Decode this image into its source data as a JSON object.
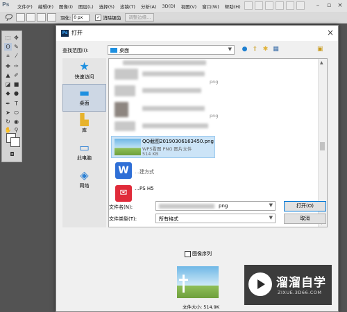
{
  "app": {
    "logo": "Ps",
    "menu": [
      "文件(F)",
      "编辑(E)",
      "图像(I)",
      "图层(L)",
      "选择(S)",
      "滤镜(T)",
      "分析(A)",
      "3D(D)",
      "视图(V)",
      "窗口(W)",
      "帮助(H)"
    ],
    "options": {
      "feather_label": "羽化:",
      "feather_value": "0 px",
      "antialias_label": "消除锯齿",
      "refine_edge_label": "调整边缘..."
    }
  },
  "dialog": {
    "title": "打开",
    "look_in_label": "查找范围(I):",
    "look_in_value": "桌面",
    "places": [
      {
        "label": "快速访问",
        "icon": "star-icon"
      },
      {
        "label": "桌面",
        "icon": "desktop-icon"
      },
      {
        "label": "库",
        "icon": "library-icon"
      },
      {
        "label": "此电脑",
        "icon": "computer-icon"
      },
      {
        "label": "网络",
        "icon": "network-icon"
      }
    ],
    "files": [
      {
        "name": "QQ截图20190306163450.png",
        "type": "WPS看图 PNG 图片文件",
        "size": "514 KB",
        "selected": true
      },
      {
        "name": "…建方式",
        "icon": "wps-writer-icon"
      },
      {
        "name": "…PS H5",
        "icon": "wps-red-icon"
      }
    ],
    "visible_fragments": [
      "png",
      "png"
    ],
    "filename_label": "文件名(N):",
    "filename_value": "png",
    "filetype_label": "文件类型(T):",
    "filetype_value": "所有格式",
    "open_button": "打开(O)",
    "cancel_button": "取消",
    "image_sequence_label": "图像序列",
    "preview_size": "文件大小: 514.9K"
  },
  "watermark": {
    "title": "溜溜自学",
    "subtitle": "ZIXUE.3D66.COM"
  }
}
